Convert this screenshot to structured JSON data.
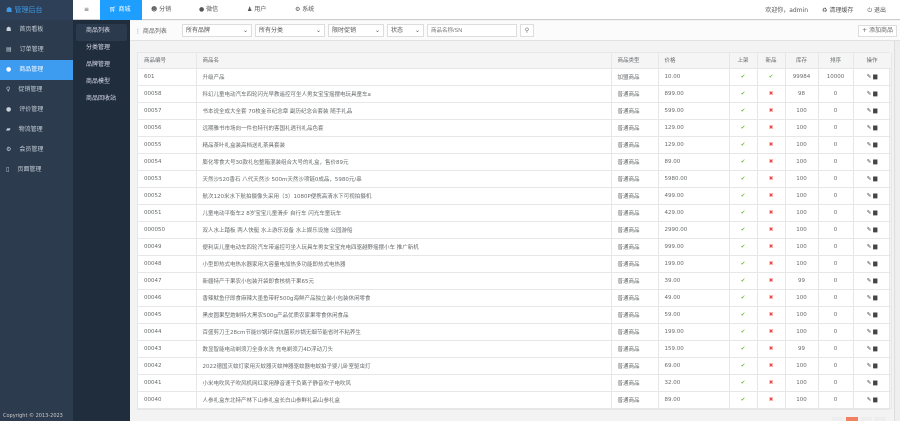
{
  "app": {
    "title": "管理后台",
    "copyright": "Copyright © 2013-2023"
  },
  "topnav": {
    "menu_icon": "menu-icon",
    "items": [
      {
        "label": "商城",
        "icon": "cart-icon"
      },
      {
        "label": "分销",
        "icon": "users-icon"
      },
      {
        "label": "微信",
        "icon": "wechat-icon"
      },
      {
        "label": "用户",
        "icon": "user-icon"
      },
      {
        "label": "系统",
        "icon": "gear-icon"
      }
    ],
    "welcome": "欢迎你，admin",
    "clear_cache": "清理缓存",
    "logout": "退出"
  },
  "sidebar": {
    "items": [
      {
        "label": "首页看板",
        "icon": "home-icon"
      },
      {
        "label": "订单管理",
        "icon": "cart-icon"
      },
      {
        "label": "商品管理",
        "icon": "box-icon"
      },
      {
        "label": "促销管理",
        "icon": "bulb-icon"
      },
      {
        "label": "评价管理",
        "icon": "comment-icon"
      },
      {
        "label": "物流管理",
        "icon": "truck-icon"
      },
      {
        "label": "会员管理",
        "icon": "gear-icon"
      },
      {
        "label": "页面管理",
        "icon": "page-icon"
      }
    ]
  },
  "subnav": {
    "items": [
      "商品列表",
      "分类管理",
      "品牌管理",
      "商品模型",
      "商品回收站"
    ]
  },
  "filter": {
    "title": "商品列表",
    "brand": "所有品牌",
    "category": "所有分类",
    "promo": "限时促销",
    "status": "状态",
    "search_placeholder": "商品名称/SN",
    "add_label": "添加商品"
  },
  "table": {
    "headers": [
      "商品编号",
      "商品名",
      "商品类型",
      "价格",
      "上架",
      "新品",
      "库存",
      "排序",
      "操作"
    ],
    "rows": [
      [
        "601",
        "升级产品",
        "加盟商品",
        "10.00",
        true,
        true,
        "99984",
        "10000"
      ],
      [
        "00058",
        "科幻儿童电动汽车四轮闪光早教遥控可坐人男女宝宝摇摆电玩具童车a",
        "普通商品",
        "899.00",
        true,
        false,
        "98",
        "0"
      ],
      [
        "00057",
        "书本说全成大全套 70枚金币纪念章 副历纪念合套装 随手礼品",
        "普通商品",
        "599.00",
        true,
        false,
        "100",
        "0"
      ],
      [
        "00056",
        "远期雅书市场向一件也特刊的客国礼遇刊礼品色套",
        "普通商品",
        "129.00",
        true,
        false,
        "100",
        "0"
      ],
      [
        "00055",
        "精品茶叶礼盒装高档送礼茶具套装",
        "普通商品",
        "129.00",
        true,
        false,
        "100",
        "0"
      ],
      [
        "00054",
        "膨化零食大号30款礼包整箱混装组合大号的礼盒，售价89元",
        "普通商品",
        "89.00",
        true,
        false,
        "100",
        "0"
      ],
      [
        "00053",
        "天然沙520香石 八代天然沙 500m天然沙项链0成品，5980元/串",
        "普通商品",
        "5980.00",
        true,
        false,
        "100",
        "0"
      ],
      [
        "00052",
        "航次120米水下航拍摄像头采用（3）1080P便携高清水下可视拍摄机",
        "普通商品",
        "499.00",
        true,
        false,
        "100",
        "0"
      ],
      [
        "00051",
        "儿童电动平衡车2 8岁宝宝儿童滑步 自行车 闪光车童玩车",
        "普通商品",
        "429.00",
        true,
        false,
        "100",
        "0"
      ],
      [
        "000050",
        "双人水上踏板 两人快艇 水上游乐设备 水上娱乐设施 公园游船",
        "普通商品",
        "2990.00",
        true,
        false,
        "100",
        "0"
      ],
      [
        "00049",
        "便利店儿童电动车四轮汽车带遥控可坐人玩具车男女宝宝充电四驱越野摇摆小车 推广新机",
        "普通商品",
        "999.00",
        true,
        false,
        "100",
        "0"
      ],
      [
        "00048",
        "小型即热式电热水器家用大容量电加热多功能即热式电热器",
        "普通商品",
        "199.00",
        true,
        false,
        "100",
        "0"
      ],
      [
        "00047",
        "新疆特产干果农小包装开袋即食核桃干果65元",
        "普通商品",
        "39.00",
        true,
        false,
        "99",
        "0"
      ],
      [
        "00046",
        "香辣鱿鱼仔即食麻辣大墨鱼带籽500g海鲜产品独立装小包装休闲零食",
        "普通商品",
        "49.00",
        true,
        false,
        "100",
        "0"
      ],
      [
        "00045",
        "黑皮圆果型炮制特大黑农500g产品优质农家果零食休闲食品",
        "普通商品",
        "59.00",
        true,
        false,
        "100",
        "0"
      ],
      [
        "00044",
        "百盛剪刀王28cm节能炒锅环保抗菌煎炒锅无烟节能省时不粘养生",
        "普通商品",
        "199.00",
        true,
        false,
        "100",
        "0"
      ],
      [
        "00043",
        "数显智能电动剃须刀全身水洗 充电剃须刀4D浮动刀头",
        "普通商品",
        "159.00",
        true,
        false,
        "99",
        "0"
      ],
      [
        "00042",
        "2022德国灭蚊灯家用灭蚊器灭蚊神器驱蚊器电蚊拍子婴儿卧室驱虫灯",
        "普通商品",
        "69.00",
        true,
        false,
        "100",
        "0"
      ],
      [
        "00041",
        "小米电吹风子吹风机网红家用静音速干负离子静音吹子电吹风",
        "普通商品",
        "32.00",
        true,
        false,
        "100",
        "0"
      ],
      [
        "00040",
        "人参礼盒东北特产林下山参礼盒长白山参鲜礼品山参礼盒",
        "普通商品",
        "89.00",
        true,
        false,
        "100",
        "0"
      ]
    ],
    "ok_symbol": "✔",
    "no_symbol": "✖",
    "edit_icon": "edit-icon",
    "delete_icon": "trash-icon"
  },
  "colors": {
    "accent": "#1e9fff",
    "sidebar": "#2c3b4e",
    "ok": "#6bbf3a",
    "no": "#ee4444"
  }
}
